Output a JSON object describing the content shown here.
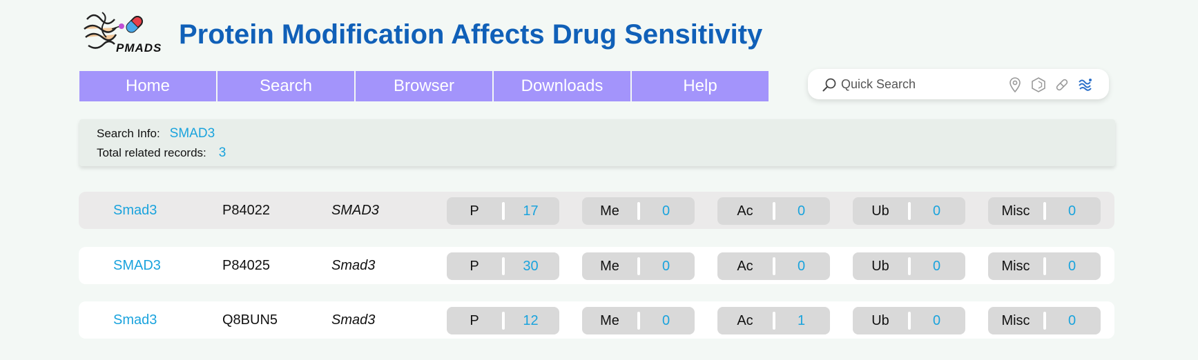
{
  "header": {
    "logo_text": "PMADS",
    "title": "Protein Modification Affects Drug Sensitivity"
  },
  "nav": {
    "items": [
      {
        "label": "Home"
      },
      {
        "label": "Search"
      },
      {
        "label": "Browser"
      },
      {
        "label": "Downloads"
      },
      {
        "label": "Help"
      }
    ]
  },
  "quick_search": {
    "placeholder": "Quick Search",
    "icons": [
      "location-pin-icon",
      "hexagon-icon",
      "pill-icon",
      "protein-structure-icon"
    ]
  },
  "search_info": {
    "info_label": "Search Info:",
    "info_value": "SMAD3",
    "total_label": "Total related records:",
    "total_value": "3"
  },
  "results": [
    {
      "name": "Smad3",
      "accession": "P84022",
      "gene": "SMAD3",
      "mods": [
        {
          "label": "P",
          "count": "17"
        },
        {
          "label": "Me",
          "count": "0"
        },
        {
          "label": "Ac",
          "count": "0"
        },
        {
          "label": "Ub",
          "count": "0"
        },
        {
          "label": "Misc",
          "count": "0"
        }
      ]
    },
    {
      "name": "SMAD3",
      "accession": "P84025",
      "gene": "Smad3",
      "mods": [
        {
          "label": "P",
          "count": "30"
        },
        {
          "label": "Me",
          "count": "0"
        },
        {
          "label": "Ac",
          "count": "0"
        },
        {
          "label": "Ub",
          "count": "0"
        },
        {
          "label": "Misc",
          "count": "0"
        }
      ]
    },
    {
      "name": "Smad3",
      "accession": "Q8BUN5",
      "gene": "Smad3",
      "mods": [
        {
          "label": "P",
          "count": "12"
        },
        {
          "label": "Me",
          "count": "0"
        },
        {
          "label": "Ac",
          "count": "1"
        },
        {
          "label": "Ub",
          "count": "0"
        },
        {
          "label": "Misc",
          "count": "0"
        }
      ]
    }
  ],
  "colors": {
    "title": "#1060b8",
    "nav_bg": "#a394fb",
    "link": "#1aa3dd",
    "first_row_bg": "#ebeaea",
    "row_bg": "#ffffff",
    "pill_bg": "#d9d9d9"
  }
}
